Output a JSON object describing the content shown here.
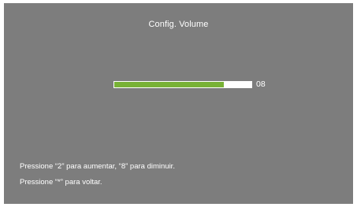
{
  "dialog": {
    "title": "Config. Volume",
    "volume": {
      "value_text": "08",
      "level_fraction": 0.8,
      "fill_color": "#78b236",
      "track_color": "#ffffff"
    },
    "hints": {
      "adjust": "Pressione “2” para aumentar, “8” para diminuir.",
      "back": "Pressione “*” para voltar."
    },
    "background_color": "#7d7d7d"
  }
}
